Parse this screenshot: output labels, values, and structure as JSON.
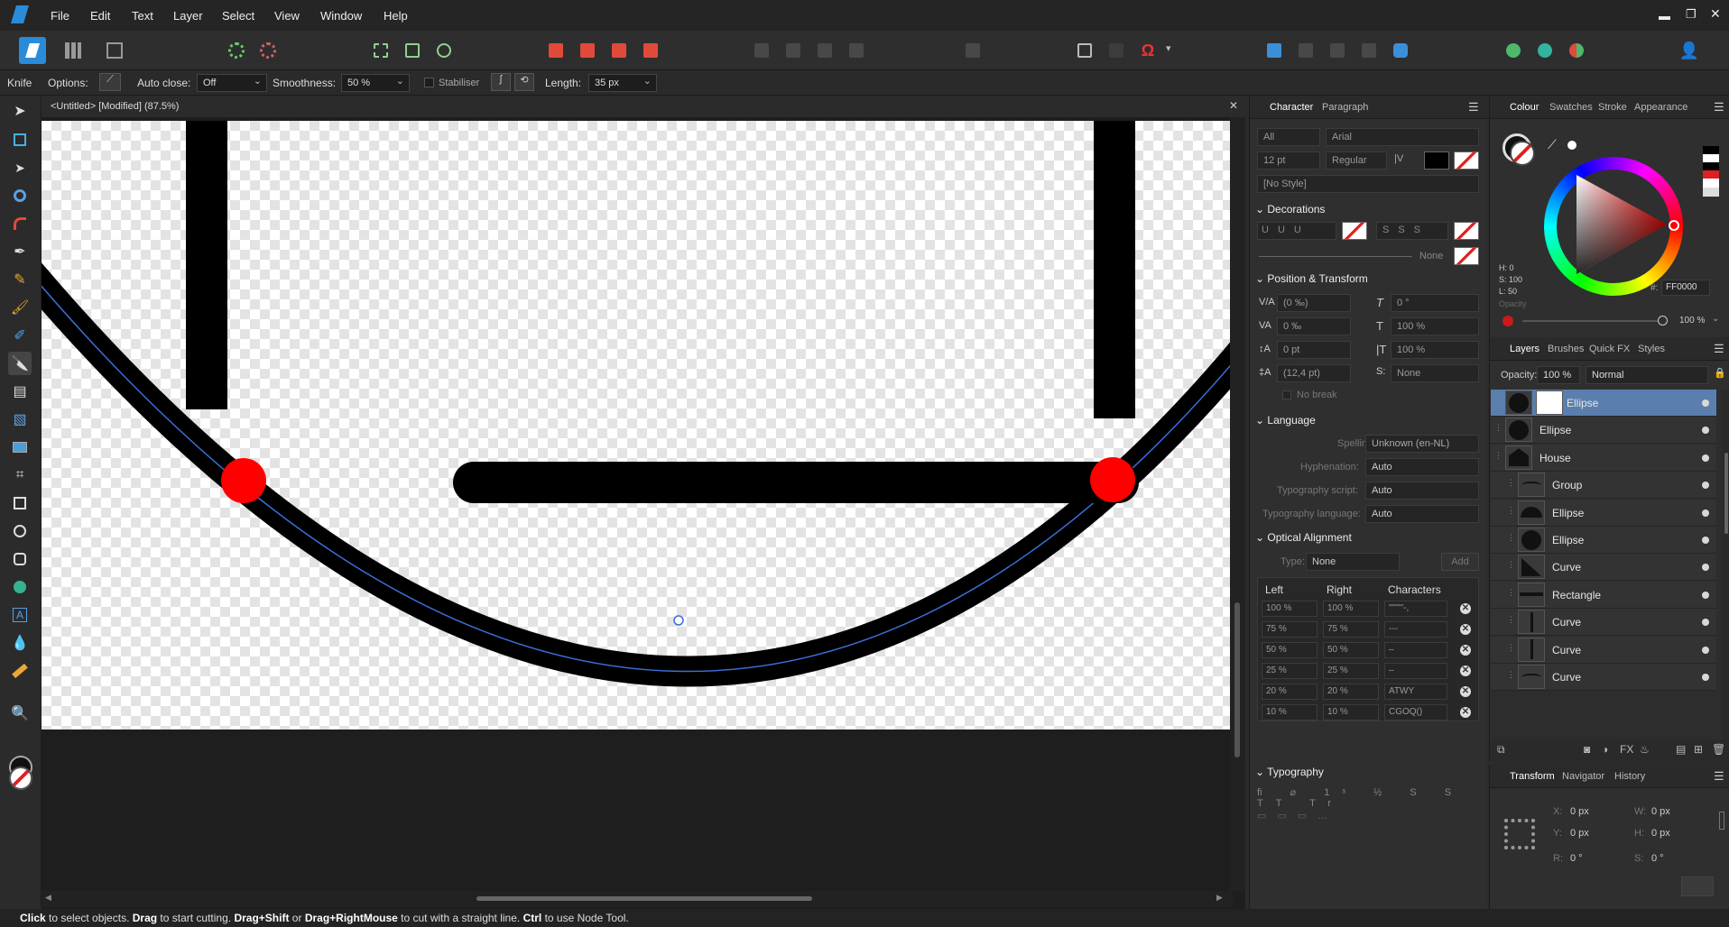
{
  "menu": {
    "items": [
      "File",
      "Edit",
      "Text",
      "Layer",
      "Select",
      "View",
      "Window",
      "Help"
    ]
  },
  "context": {
    "tool_name": "Knife",
    "options_label": "Options:",
    "auto_close_label": "Auto close:",
    "auto_close_value": "Off",
    "smoothness_label": "Smoothness:",
    "smoothness_value": "50 %",
    "stabiliser_label": "Stabiliser",
    "length_label": "Length:",
    "length_value": "35 px"
  },
  "document": {
    "title": "<Untitled> [Modified] (87.5%)"
  },
  "character": {
    "tabs": [
      "Character",
      "Paragraph"
    ],
    "scope": "All",
    "font": "Arial",
    "size": "12 pt",
    "weight": "Regular",
    "style": "[No Style]",
    "decorations_title": "Decorations",
    "decor_none": "None",
    "position_title": "Position & Transform",
    "kerning": "(0 ‰)",
    "tracking": "0 ‰",
    "baseline": "0 pt",
    "leading": "(12,4 pt)",
    "shear": "0 °",
    "vscale": "100 %",
    "hscale": "100 %",
    "leading_opt": "None",
    "no_break": "No break",
    "language_title": "Language",
    "spelling_label": "Spelling:",
    "spelling_value": "Unknown (en-NL)",
    "hyphenation_label": "Hyphenation:",
    "hyphenation_value": "Auto",
    "script_label": "Typography script:",
    "script_value": "Auto",
    "lang_label": "Typography language:",
    "lang_value": "Auto",
    "optical_title": "Optical Alignment",
    "type_label": "Type:",
    "type_value": "None",
    "add_label": "Add",
    "col_left": "Left",
    "col_right": "Right",
    "col_chars": "Characters",
    "optical_rows": [
      {
        "left": "100 %",
        "right": "100 %",
        "chars": "\"\"\"\"'-,"
      },
      {
        "left": "75 %",
        "right": "75 %",
        "chars": "---"
      },
      {
        "left": "50 %",
        "right": "50 %",
        "chars": "–"
      },
      {
        "left": "25 %",
        "right": "25 %",
        "chars": "–"
      },
      {
        "left": "20 %",
        "right": "20 %",
        "chars": "ATWY"
      },
      {
        "left": "10 %",
        "right": "10 %",
        "chars": "CGOQ()"
      }
    ],
    "typography_title": "Typography"
  },
  "colour": {
    "tabs": [
      "Colour",
      "Swatches",
      "Stroke",
      "Appearance"
    ],
    "h": "H: 0",
    "s": "S: 100",
    "l": "L: 50",
    "hex_label": "#:",
    "hex": "FF0000",
    "opacity_label": "Opacity",
    "opacity": "100 %"
  },
  "layers": {
    "tabs": [
      "Layers",
      "Brushes",
      "Quick FX",
      "Styles"
    ],
    "opacity_label": "Opacity:",
    "opacity": "100 %",
    "blend": "Normal",
    "items": [
      {
        "name": "Ellipse"
      },
      {
        "name": "Ellipse"
      },
      {
        "name": "House"
      },
      {
        "name": "Group"
      },
      {
        "name": "Ellipse"
      },
      {
        "name": "Ellipse"
      },
      {
        "name": "Curve"
      },
      {
        "name": "Rectangle"
      },
      {
        "name": "Curve"
      },
      {
        "name": "Curve"
      },
      {
        "name": "Curve"
      }
    ]
  },
  "transform": {
    "tabs": [
      "Transform",
      "Navigator",
      "History"
    ],
    "x_label": "X:",
    "x": "0 px",
    "y_label": "Y:",
    "y": "0 px",
    "w_label": "W:",
    "w": "0 px",
    "h_label": "H:",
    "h": "0 px",
    "r_label": "R:",
    "r": "0 °",
    "s_label": "S:",
    "s": "0 °"
  },
  "status": {
    "click": "Click",
    "t1": " to select objects. ",
    "drag": "Drag",
    "t2": " to start cutting. ",
    "dragshift": "Drag+Shift",
    "t3": " or ",
    "dragright": "Drag+RightMouse",
    "t4": " to cut with a straight line. ",
    "ctrl": "Ctrl",
    "t5": " to use Node Tool."
  },
  "colors": {
    "accent": "#5a7fae",
    "red": "#ff0000",
    "app_bg": "#2b2b2b"
  }
}
